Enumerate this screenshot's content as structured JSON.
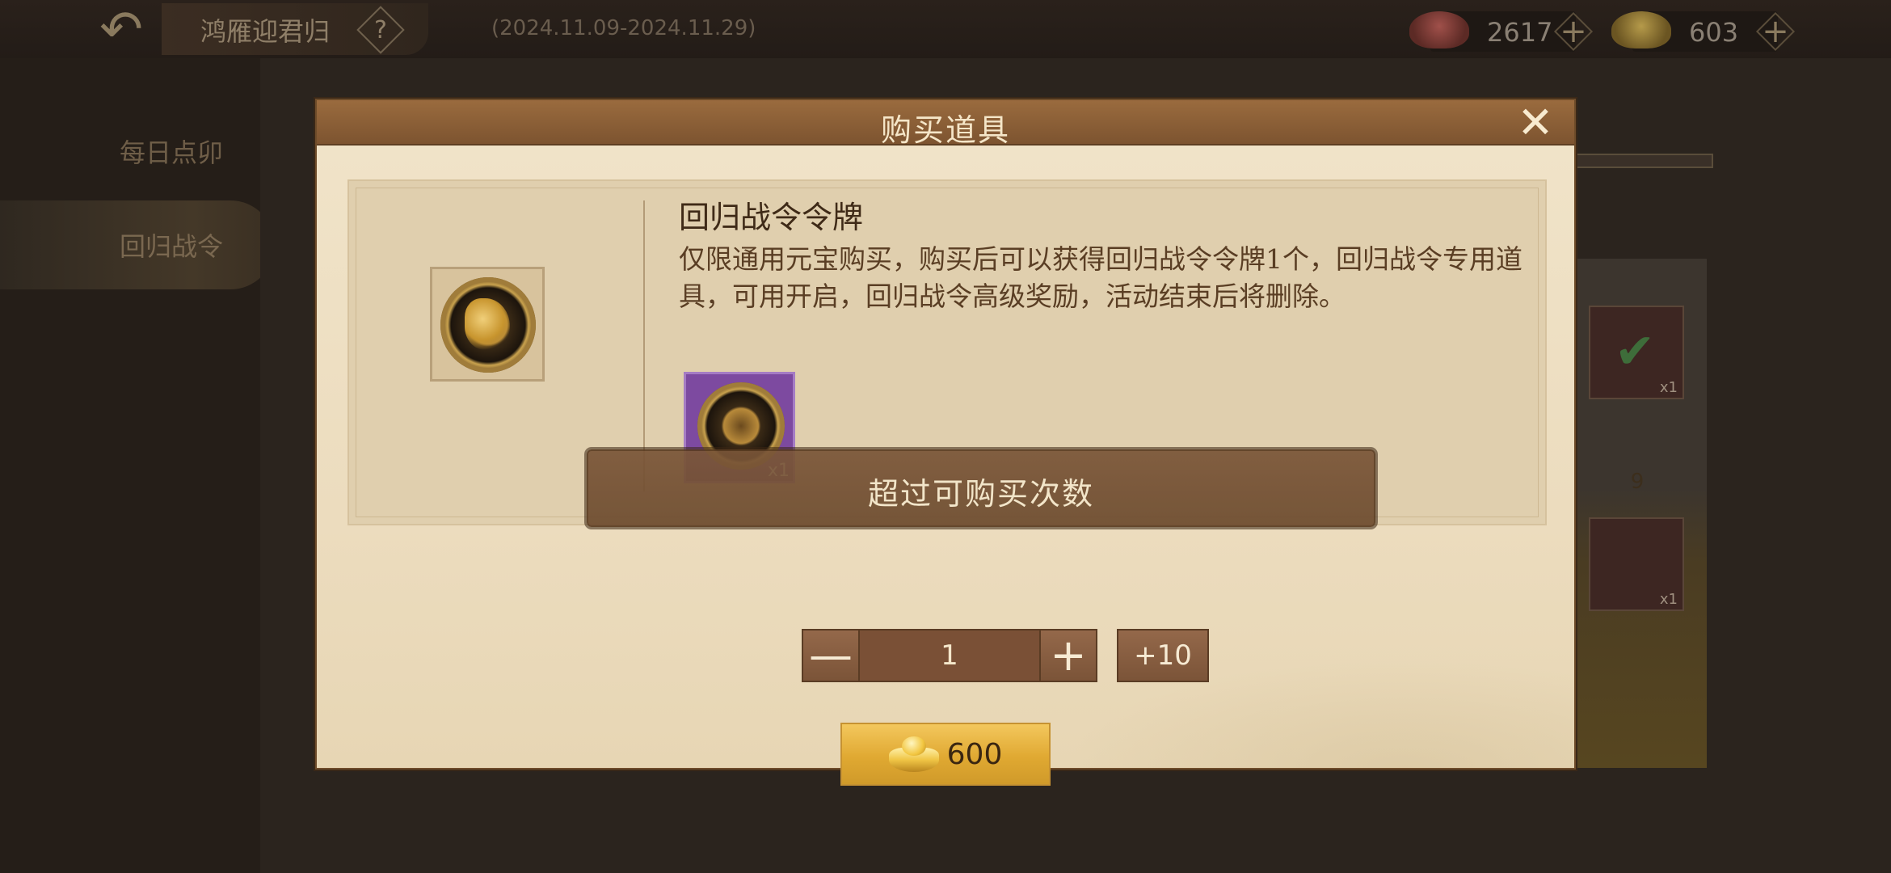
{
  "header": {
    "title": "鸿雁迎君归",
    "help_icon": "?",
    "date_range": "(2024.11.09-2024.11.29)",
    "back_icon": "back-arrow-icon"
  },
  "currencies": [
    {
      "name": "red-ingot",
      "value": "2617",
      "plus": "+"
    },
    {
      "name": "gold-ingot",
      "value": "603",
      "plus": "+"
    }
  ],
  "sidebar": {
    "items": [
      {
        "label": "每日点卯",
        "active": false
      },
      {
        "label": "回归战令",
        "active": true
      }
    ]
  },
  "background_panel": {
    "level_badge": "9",
    "slot_count_1": "x1",
    "slot_count_2": "x1"
  },
  "modal": {
    "title": "购买道具",
    "close_icon": "✕",
    "item": {
      "name": "回归战令令牌",
      "description": "仅限通用元宝购买，购买后可以获得回归战令令牌1个，回归战令专用道具，可用开启，回归战令高级奖励，活动结束后将删除。",
      "reward_qty": "x1"
    },
    "toast": "超过可购买次数",
    "quantity": {
      "minus": "—",
      "value": "1",
      "plus": "+",
      "plus10": "+10"
    },
    "buy": {
      "price": "600"
    }
  },
  "colors": {
    "modal_header": "#8a5e36",
    "modal_body": "#ecdcbe",
    "buy_button": "#e0a932",
    "reward_icon_bg": "#7d4aa0"
  }
}
